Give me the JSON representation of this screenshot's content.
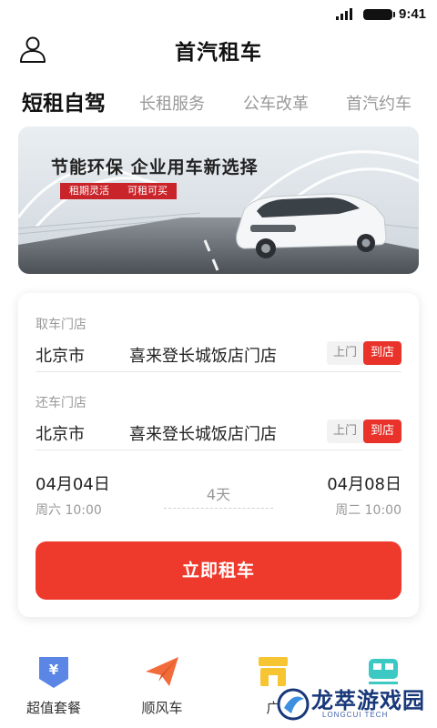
{
  "status_bar": {
    "time": "9:41"
  },
  "header": {
    "title": "首汽租车",
    "user_icon": "user-icon"
  },
  "tabs": [
    {
      "label": "短租自驾",
      "active": true
    },
    {
      "label": "长租服务",
      "active": false
    },
    {
      "label": "公车改革",
      "active": false
    },
    {
      "label": "首汽约车",
      "active": false
    }
  ],
  "banner": {
    "headline": "节能环保  企业用车新选择",
    "tags": [
      "租期灵活",
      "可租可买"
    ]
  },
  "booking": {
    "pickup": {
      "label": "取车门店",
      "city": "北京市",
      "store": "喜来登长城饭店门店",
      "option_off": "上门",
      "option_on": "到店"
    },
    "return": {
      "label": "还车门店",
      "city": "北京市",
      "store": "喜来登长城饭店门店",
      "option_off": "上门",
      "option_on": "到店"
    },
    "start_date": "04月04日",
    "start_weekday": "周六 10:00",
    "duration": "4天",
    "end_date": "04月08日",
    "end_weekday": "周二 10:00",
    "submit_label": "立即租车"
  },
  "bottom_nav": [
    {
      "label": "超值套餐",
      "icon": "yuan-tag-icon",
      "color": "#5b86e5"
    },
    {
      "label": "顺风车",
      "icon": "paper-plane-icon",
      "color": "#f26b3a"
    },
    {
      "label": "广",
      "icon": "store-icon",
      "color": "#f7c531"
    },
    {
      "label": "",
      "icon": "train-icon",
      "color": "#3cc9c3"
    }
  ],
  "watermark": {
    "text": "龙萃游戏园",
    "sub": "LONGCUI TECH"
  },
  "colors": {
    "accent": "#ee3a2c",
    "toggle_on": "#e8322a",
    "text_muted": "#999999"
  }
}
